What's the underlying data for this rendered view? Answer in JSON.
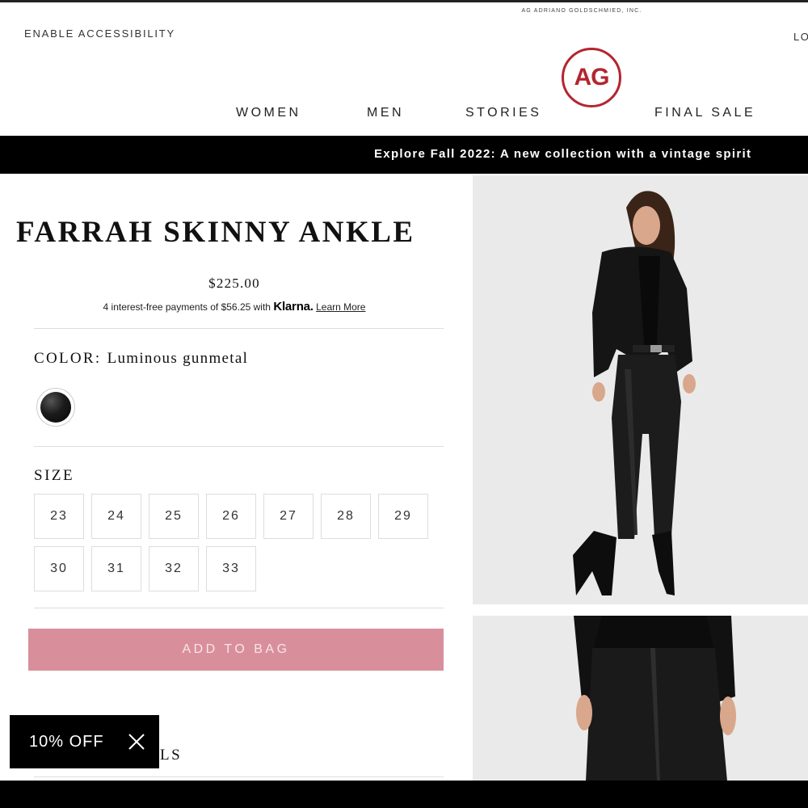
{
  "header": {
    "brand_small": "AG ADRIANO GOLDSCHMIED, INC.",
    "accessibility": "ENABLE ACCESSIBILITY",
    "login": "LO",
    "logo_text": "AG",
    "nav": [
      "WOMEN",
      "MEN",
      "STORIES",
      "FINAL SALE"
    ]
  },
  "promo": {
    "text": "Explore Fall 2022: A new collection with a vintage spirit"
  },
  "product": {
    "title": "FARRAH SKINNY ANKLE",
    "price": "$225.00",
    "klarna": {
      "text": "4 interest-free payments of $56.25 with",
      "brand": "Klarna.",
      "link": "Learn More"
    },
    "color_label": "COLOR",
    "color_separator": ":",
    "color_value": "Luminous gunmetal",
    "size_label": "SIZE",
    "sizes": [
      "23",
      "24",
      "25",
      "26",
      "27",
      "28",
      "29",
      "30",
      "31",
      "32",
      "33"
    ],
    "add_to_bag": "ADD TO BAG",
    "details_partial": "LS"
  },
  "discount_popup": {
    "text": "10% OFF"
  },
  "colors": {
    "brand_red": "#b3252f",
    "button_pink": "#d98f9b",
    "banner_black": "#000000"
  }
}
